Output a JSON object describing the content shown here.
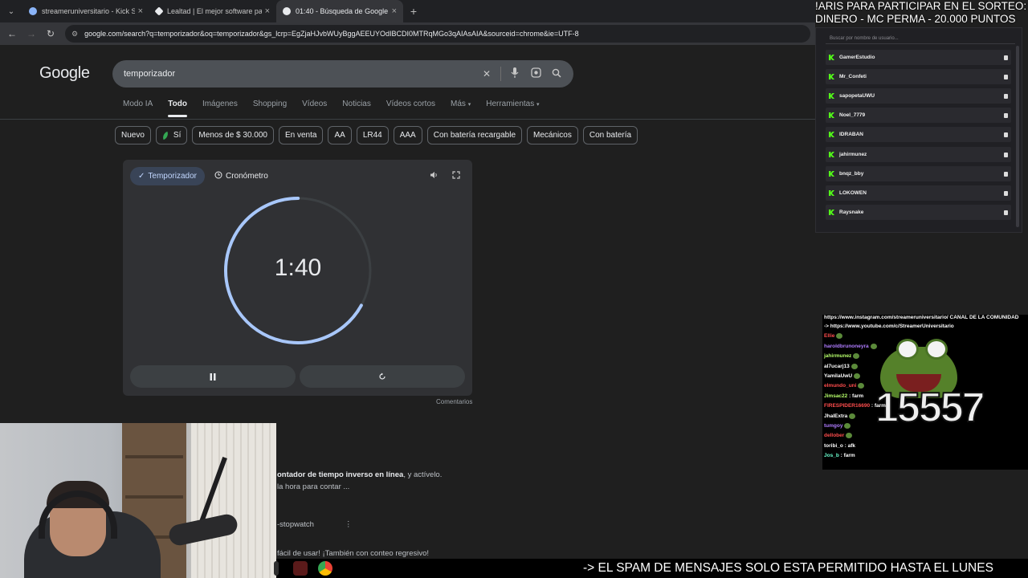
{
  "browser": {
    "tabs": [
      {
        "title": "streameruniversitario - Kick Sta",
        "favicon_color": "#8ab4f8",
        "active": false
      },
      {
        "title": "Lealtad | El mejor software para",
        "favicon_color": "#e8eaed",
        "active": false
      },
      {
        "title": "01:40 - Búsqueda de Google",
        "favicon_color": "#e8eaed",
        "active": true
      }
    ],
    "url": "google.com/search?q=temporizador&oq=temporizador&gs_lcrp=EgZjaHJvbWUyBggAEEUYOdIBCDI0MTRqMGo3qAIAsAIA&sourceid=chrome&ie=UTF-8"
  },
  "google": {
    "logo": "Google",
    "query": "temporizador",
    "tabs": [
      "Modo IA",
      "Todo",
      "Imágenes",
      "Shopping",
      "Vídeos",
      "Noticias",
      "Vídeos cortos",
      "Más",
      "Herramientas"
    ],
    "active_tab": "Todo",
    "chips": [
      "Nuevo",
      "Sí",
      "Menos de $ 30.000",
      "En venta",
      "AA",
      "LR44",
      "AAA",
      "Con batería recargable",
      "Mecánicos",
      "Con batería"
    ]
  },
  "timer": {
    "modes": {
      "timer": "Temporizador",
      "stopwatch": "Cronómetro"
    },
    "active_mode": "timer",
    "display": "1:40",
    "progress": 0.33,
    "accent": "#a8c7fa",
    "track": "#3c4043",
    "feedback": "Comentarios"
  },
  "results": {
    "line1_bold": "ontador de tiempo inverso en línea",
    "line1_rest": ", y actívelo.",
    "line2": "la hora para contar ...",
    "line3": "-stopwatch",
    "line4": "fácil de usar! ¡También con conteo regresivo!"
  },
  "overlay": {
    "top_line1": "!ARIS PARA PARTICIPAR EN EL SORTEO:",
    "top_line2": "DINERO - MC PERMA - 20.000 PUNTOS",
    "participants_search_placeholder": "Buscar por nombre de usuario...",
    "participants": [
      "GamerEstudio",
      "Mr_Confeti",
      "sapopetaUWU",
      "Noel_7779",
      "IDRABAN",
      "jahirmunez",
      "bnqz_bby",
      "LOKOWEN",
      "Raysnake"
    ],
    "chat": [
      {
        "user": "https://www.instagram.com/streameruniversitario/ CANAL DE LA COMUNIDAD",
        "color": "#ffffff",
        "msg": ""
      },
      {
        "user": "-> https://www.youtube.com/c/StreamerUniversitario",
        "color": "#ffffff",
        "msg": ""
      },
      {
        "user": "Ellie",
        "color": "#ff4d4d",
        "msg": ""
      },
      {
        "user": "haroldbrunoneyra",
        "color": "#b07cff",
        "msg": ""
      },
      {
        "user": "jahirmunez",
        "color": "#b6ff6b",
        "msg": ""
      },
      {
        "user": "al7ucarj13",
        "color": "#ffffff",
        "msg": ""
      },
      {
        "user": "YamilaUwU",
        "color": "#ffffff",
        "msg": ""
      },
      {
        "user": "elmundo_uni",
        "color": "#ff4d4d",
        "msg": ""
      },
      {
        "user": "Jimsac22",
        "color": "#b6ff6b",
        "msg": " : farm"
      },
      {
        "user": "FIRESPIDER16690",
        "color": "#ff4d4d",
        "msg": " : farm"
      },
      {
        "user": "JhalExtra",
        "color": "#ffffff",
        "msg": ""
      },
      {
        "user": "tumgoy",
        "color": "#b07cff",
        "msg": ""
      },
      {
        "user": "dellober",
        "color": "#ff4d4d",
        "msg": ""
      },
      {
        "user": "toribi_o",
        "color": "#ffffff",
        "msg": " : afk"
      },
      {
        "user": "Jos_b",
        "color": "#6bffd0",
        "msg": " : farm"
      }
    ],
    "counter": "15557",
    "marquee": "-> EL SPAM DE MENSAJES SOLO ESTA PERMITIDO HASTA EL LUNES"
  }
}
